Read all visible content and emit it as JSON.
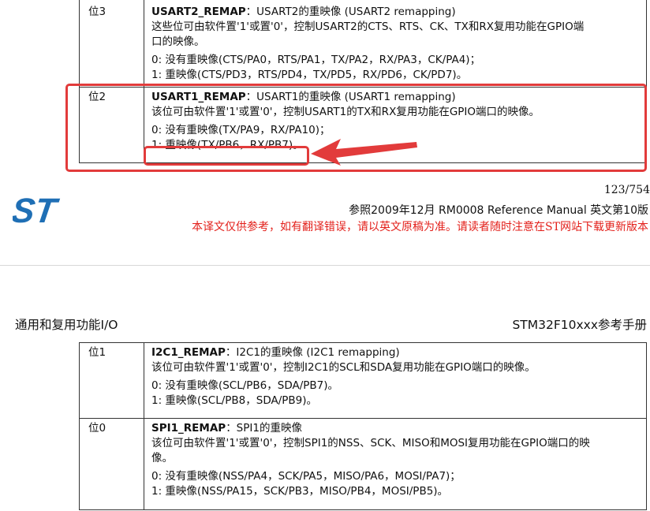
{
  "top_table": {
    "rows": [
      {
        "bit": "位3",
        "name": "USART2_REMAP",
        "title_rest": "：USART2的重映像 (USART2 remapping)",
        "desc_lines": [
          "这些位可由软件置'1'或置'0'，控制USART2的CTS、RTS、CK、TX和RX复用功能在GPIO端",
          "口的映像。"
        ],
        "opt0": "0: 没有重映像(CTS/PA0，RTS/PA1，TX/PA2，RX/PA3，CK/PA4)；",
        "opt1": "1: 重映像(CTS/PD3，RTS/PD4，TX/PD5，RX/PD6，CK/PD7)。"
      },
      {
        "bit": "位2",
        "name": "USART1_REMAP",
        "title_rest": "：USART1的重映像 (USART1 remapping)",
        "desc_lines": [
          "该位可由软件置'1'或置'0'，控制USART1的TX和RX复用功能在GPIO端口的映像。"
        ],
        "opt0": "0: 没有重映像(TX/PA9，RX/PA10)；",
        "opt1": "1: 重映像(TX/PB6，RX/PB7)。"
      }
    ]
  },
  "footer": {
    "page_number": "123/754",
    "reference": "参照2009年12月 RM0008 Reference Manual  英文第10版",
    "notice": "本译文仅供参考，如有翻译错误，请以英文原稿为准。请读者随时注意在ST网站下载更新版本",
    "logo_text": "ST"
  },
  "header": {
    "left": "通用和复用功能I/O",
    "right": "STM32F10xxx参考手册"
  },
  "bottom_table": {
    "rows": [
      {
        "bit": "位1",
        "name": "I2C1_REMAP",
        "title_rest": "：I2C1的重映像 (I2C1 remapping)",
        "desc_lines": [
          "该位可由软件置'1'或置'0'，控制I2C1的SCL和SDA复用功能在GPIO端口的映像。"
        ],
        "opt0": "0: 没有重映像(SCL/PB6，SDA/PB7)。",
        "opt1": "1: 重映像(SCL/PB8，SDA/PB9)。"
      },
      {
        "bit": "位0",
        "name": "SPI1_REMAP",
        "title_rest": "：SPI1的重映像",
        "desc_lines": [
          "该位可由软件置'1'或置'0'，控制SPI1的NSS、SCK、MISO和MOSI复用功能在GPIO端口的映",
          "像。"
        ],
        "opt0": "0: 没有重映像(NSS/PA4，SCK/PA5，MISO/PA6，MOSI/PA7)；",
        "opt1": "1: 重映像(NSS/PA15，SCK/PB3，MISO/PB4，MOSI/PB5)。"
      }
    ]
  },
  "colors": {
    "highlight": "#e23b3b",
    "notice_text": "#e3201b",
    "logo_blue": "#1f6fb5"
  }
}
